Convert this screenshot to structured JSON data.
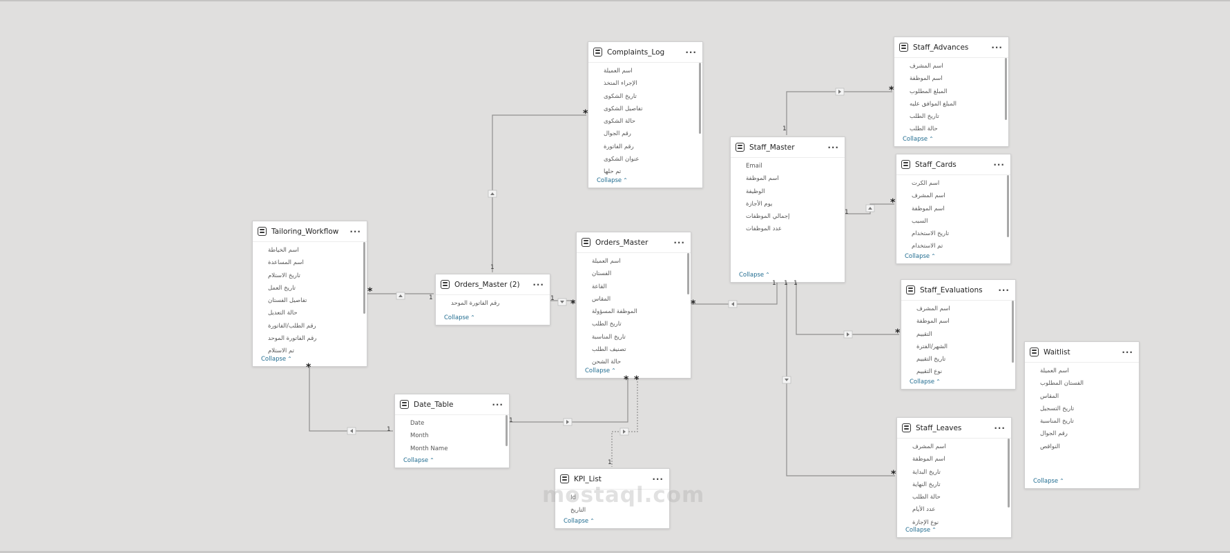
{
  "tables": [
    {
      "key": "complaints",
      "name": "Complaints_Log",
      "fields": [
        "اسم العميلة",
        "الإجراء المتخذ",
        "تاريخ الشكوى",
        "تفاصيل الشكوى",
        "حالة الشكوى",
        "رقم الجوال",
        "رقم الفاتورة",
        "عنوان الشكوى",
        "تم حلها"
      ],
      "collapse": "Collapse"
    },
    {
      "key": "staff_advances",
      "name": "Staff_Advances",
      "fields": [
        "اسم المشرف",
        "اسم الموظفة",
        "المبلغ المطلوب",
        "المبلغ الموافق عليه",
        "تاريخ الطلب",
        "حالة الطلب"
      ],
      "collapse": "Collapse"
    },
    {
      "key": "staff_master",
      "name": "Staff_Master",
      "fields": [
        "Email",
        "اسم الموظفة",
        "الوظيفة",
        "يوم الأجازة",
        "إجمالي الموظفات",
        "عدد الموظفات"
      ],
      "collapse": "Collapse"
    },
    {
      "key": "staff_cards",
      "name": "Staff_Cards",
      "fields": [
        "اسم الكرت",
        "اسم المشرف",
        "اسم الموظفة",
        "السبب",
        "تاريخ الاستخدام",
        "تم الاستخدام"
      ],
      "collapse": "Collapse"
    },
    {
      "key": "tailoring",
      "name": "Tailoring_Workflow",
      "fields": [
        "اسم الخياطة",
        "اسم المساعدة",
        "تاريخ الاستلام",
        "تاريخ العمل",
        "تفاصيل الفستان",
        "حالة التعديل",
        "رقم الطلب/الفاتورة",
        "رقم الفاتورة الموحد",
        "تم الاستلام"
      ],
      "collapse": "Collapse"
    },
    {
      "key": "orders2",
      "name": "Orders_Master (2)",
      "fields": [
        "رقم الفاتورة الموحد"
      ],
      "collapse": "Collapse"
    },
    {
      "key": "orders",
      "name": "Orders_Master",
      "fields": [
        "اسم العميلة",
        "الفستان",
        "القاعة",
        "المقاس",
        "الموظفة المسؤولة",
        "تاريخ الطلب",
        "تاريخ المناسبة",
        "تصنيف الطلب",
        "حالة الشحن"
      ],
      "collapse": "Collapse"
    },
    {
      "key": "staff_eval",
      "name": "Staff_Evaluations",
      "fields": [
        "اسم المشرف",
        "اسم الموظفة",
        "التقييم",
        "الشهر/الفترة",
        "تاريخ التقييم",
        "نوع التقييم"
      ],
      "collapse": "Collapse"
    },
    {
      "key": "waitlist",
      "name": "Waitlist",
      "fields": [
        "اسم العميلة",
        "الفستان المطلوب",
        "المقاس",
        "تاريخ التسجيل",
        "تاريخ المناسبة",
        "رقم الجوال",
        "النواقص"
      ],
      "collapse": "Collapse"
    },
    {
      "key": "date_table",
      "name": "Date_Table",
      "fields": [
        "Date",
        "Month",
        "Month Name"
      ],
      "collapse": "Collapse"
    },
    {
      "key": "staff_leaves",
      "name": "Staff_Leaves",
      "fields": [
        "اسم المشرف",
        "اسم الموظفة",
        "تاريخ البداية",
        "تاريخ النهاية",
        "حالة الطلب",
        "عدد الأيام",
        "نوع الإجازة"
      ],
      "collapse": "Collapse"
    },
    {
      "key": "kpi",
      "name": "KPI_List",
      "fields": [
        "Id",
        "التاريخ"
      ],
      "collapse": "Collapse"
    }
  ],
  "cardinality": {
    "one": "1",
    "many": "*"
  },
  "watermark": "mostaql.com",
  "colors": {
    "background": "#e0dfde",
    "line": "#8f8f8f",
    "link": "#1f6b8f"
  }
}
